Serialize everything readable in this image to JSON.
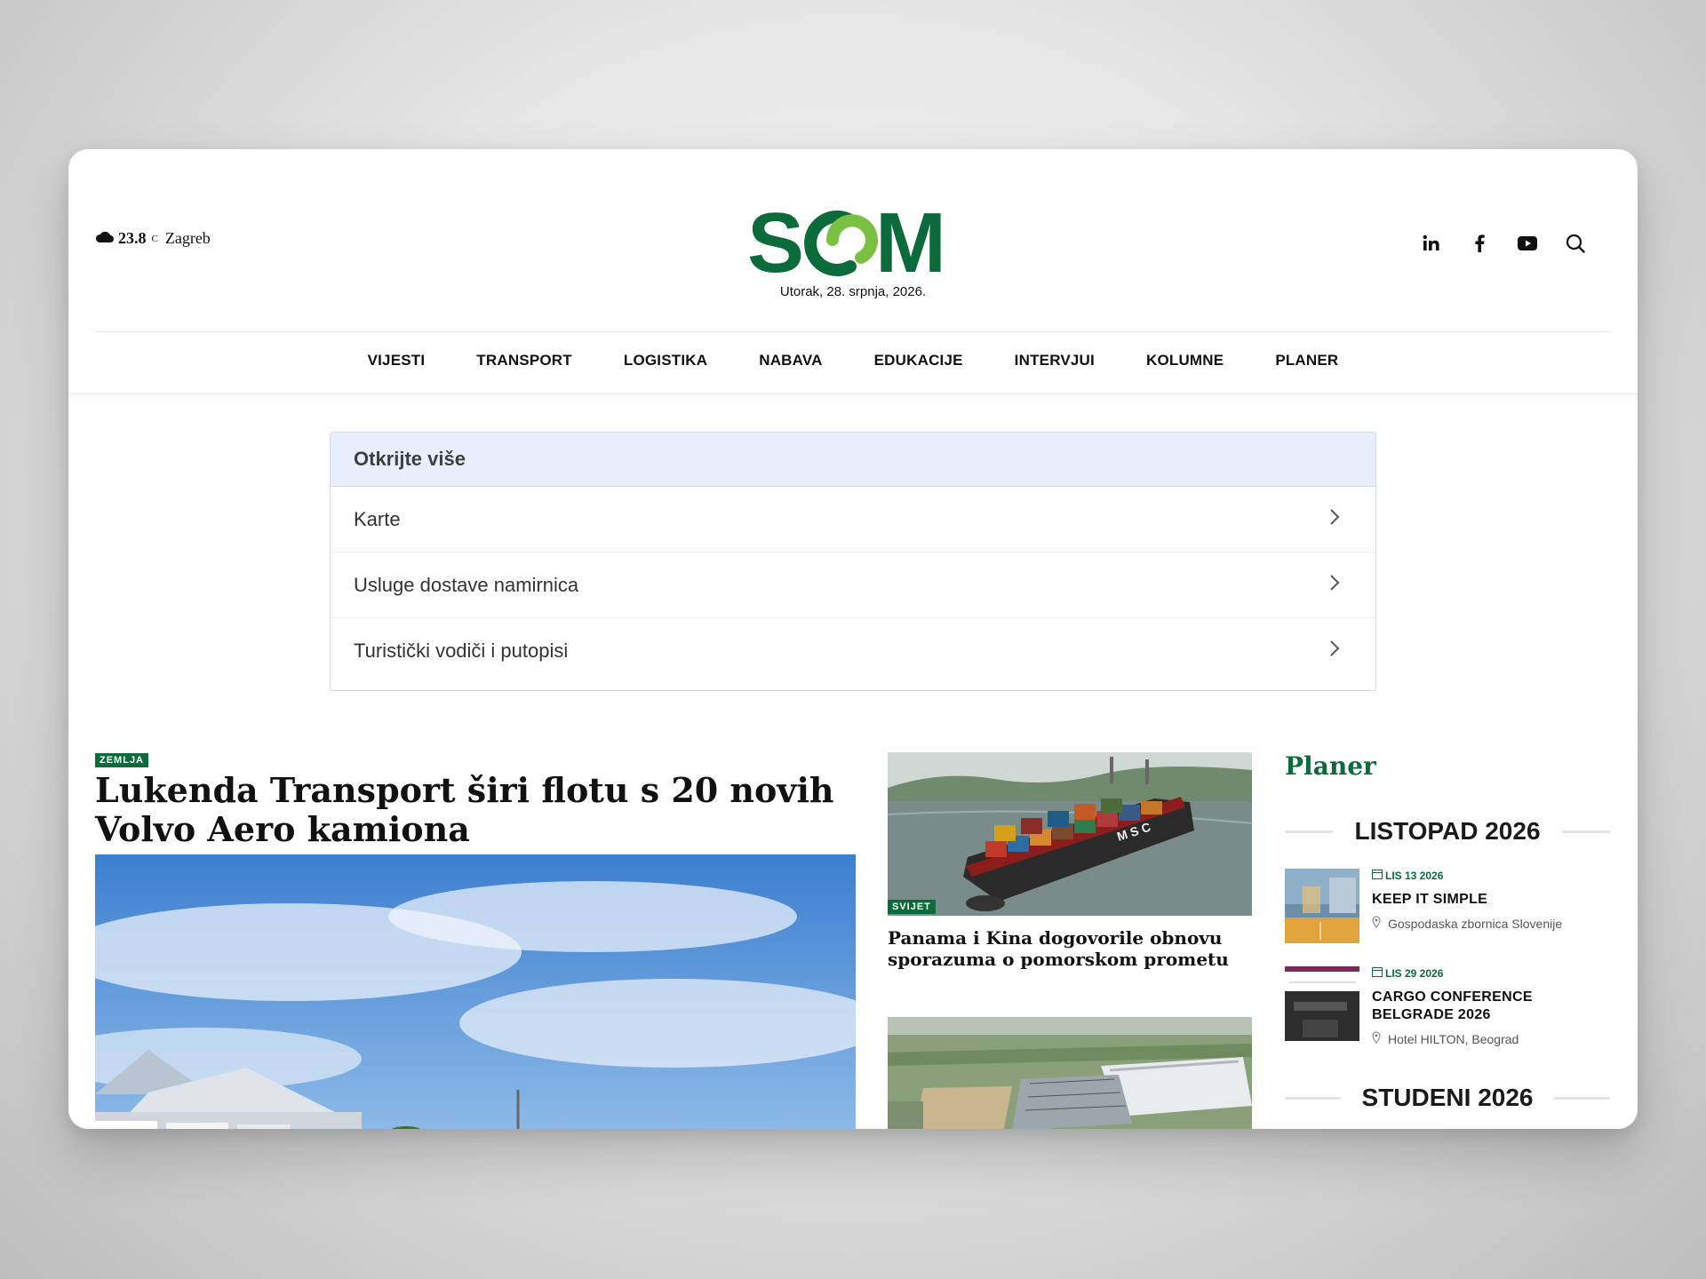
{
  "header": {
    "weather_temp": "23.8",
    "weather_unit": "C",
    "weather_city": "Zagreb",
    "logo_text": "SGM",
    "date": "Utorak, 28. srpnja, 2026.",
    "social_icons": [
      "linkedin-icon",
      "facebook-icon",
      "youtube-icon",
      "search-icon"
    ]
  },
  "nav": {
    "items": [
      "VIJESTI",
      "TRANSPORT",
      "LOGISTIKA",
      "NABAVA",
      "EDUKACIJE",
      "INTERVJUI",
      "KOLUMNE",
      "PLANER"
    ]
  },
  "discover": {
    "title": "Otkrijte više",
    "items": [
      "Karte",
      "Usluge dostave namirnica",
      "Turistički vodiči i putopisi"
    ]
  },
  "main_article": {
    "tag": "ZEMLJA",
    "title": "Lukenda Transport širi flotu s 20 novih Volvo Aero kamiona"
  },
  "side_articles": [
    {
      "tag": "SVIJET",
      "title": "Panama i Kina dogovorile obnovu sporazuma o pomorskom prometu"
    },
    {
      "tag": "",
      "title": ""
    }
  ],
  "planer": {
    "title": "Planer",
    "months": [
      "LISTOPAD 2026",
      "STUDENI 2026"
    ],
    "events": [
      {
        "date": "LIS 13 2026",
        "name": "KEEP IT SIMPLE",
        "location": "Gospodaska zbornica Slovenije"
      },
      {
        "date": "LIS 29 2026",
        "name": "CARGO CONFERENCE BELGRADE 2026",
        "location": "Hotel HILTON, Beograd"
      }
    ]
  },
  "colors": {
    "brand_green": "#0b6b3a",
    "logo_light_green": "#7ac143",
    "discover_header_bg": "#e8eefb"
  }
}
